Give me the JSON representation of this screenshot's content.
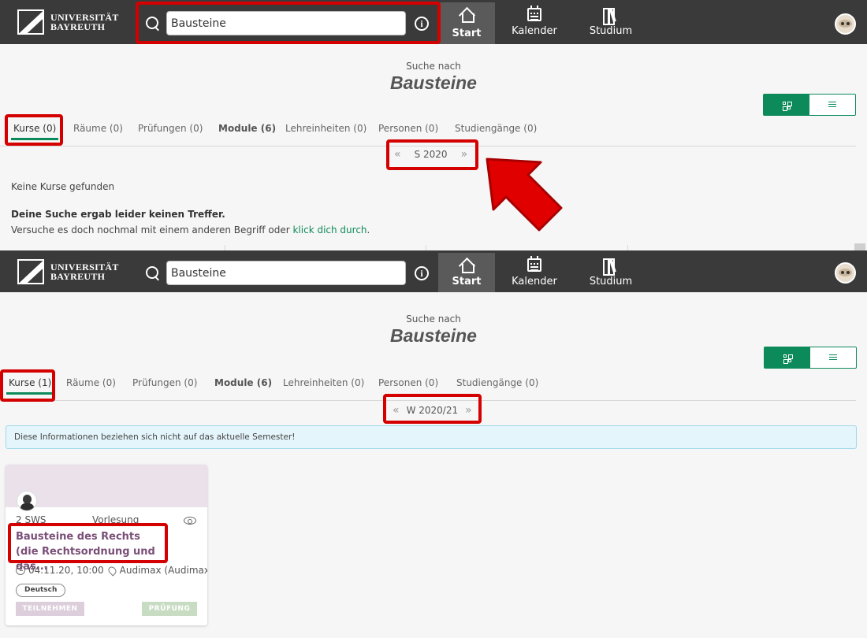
{
  "brand": {
    "line1": "UNIVERSITÄT",
    "line2": "BAYREUTH"
  },
  "search": {
    "value": "Bausteine"
  },
  "nav": {
    "start": "Start",
    "kalender": "Kalender",
    "studium": "Studium"
  },
  "icons": [
    "university-logo-icon",
    "search-icon",
    "info-icon",
    "home-icon",
    "calendar-icon",
    "books-icon",
    "avatar-icon",
    "grid-view-icon",
    "list-view-icon",
    "chevron-left-icon",
    "chevron-right-icon",
    "eye-icon",
    "clock-icon",
    "location-pin-icon",
    "red-arrow-icon"
  ],
  "colors": {
    "navbar": "#3a3a3a",
    "accent": "#0d8a5a",
    "highlight": "#d40000",
    "course_title": "#7a4f78"
  },
  "top": {
    "search_label": "Suche nach",
    "query": "Bausteine",
    "tabs": [
      {
        "label": "Kurse (0)"
      },
      {
        "label": "Räume (0)"
      },
      {
        "label": "Prüfungen (0)"
      },
      {
        "label": "Module (6)"
      },
      {
        "label": "Lehreinheiten (0)"
      },
      {
        "label": "Personen (0)"
      },
      {
        "label": "Studiengänge (0)"
      }
    ],
    "semester_prev": "«",
    "semester": "S 2020",
    "semester_next": "»",
    "no_results": "Keine Kurse gefunden",
    "no_match_bold": "Deine Suche ergab leider keinen Treffer.",
    "retry_text": "Versuche es doch nochmal mit einem anderen Begriff oder ",
    "retry_link": "klick dich durch",
    "retry_end": "."
  },
  "bottom": {
    "search_label": "Suche nach",
    "query": "Bausteine",
    "tabs": [
      {
        "label": "Kurse (1)"
      },
      {
        "label": "Räume (0)"
      },
      {
        "label": "Prüfungen (0)"
      },
      {
        "label": "Module (6)"
      },
      {
        "label": "Lehreinheiten (0)"
      },
      {
        "label": "Personen (0)"
      },
      {
        "label": "Studiengänge (0)"
      }
    ],
    "semester_prev": "«",
    "semester": "W 2020/21",
    "semester_next": "»",
    "alert": "Diese Informationen beziehen sich nicht auf das aktuelle Semester!",
    "card": {
      "sws": "2 SWS",
      "type": "Vorlesung",
      "title": "Bausteine des Rechts (die Rechtsordnung und das...",
      "datetime": "04.11.20, 10:00",
      "room": "Audimax (Audimax)",
      "language": "Deutsch",
      "btn_join": "TEILNEHMEN",
      "btn_exam": "PRÜFUNG"
    }
  }
}
